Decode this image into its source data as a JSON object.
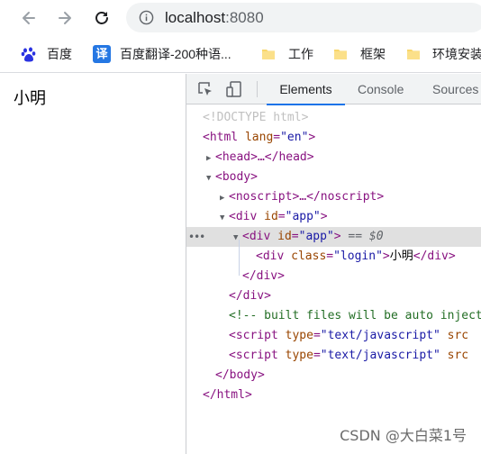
{
  "toolbar": {
    "url_host": "localhost",
    "url_port": ":8080"
  },
  "bookmarks": [
    {
      "label": "百度",
      "icon": "baidu-icon"
    },
    {
      "label": "百度翻译-200种语...",
      "icon": "fanyi-icon",
      "icon_text": "译"
    },
    {
      "label": "工作",
      "icon": "folder-icon"
    },
    {
      "label": "框架",
      "icon": "folder-icon"
    },
    {
      "label": "环境安装",
      "icon": "folder-icon"
    }
  ],
  "page": {
    "text": "小明"
  },
  "devtools": {
    "tabs": [
      "Elements",
      "Console",
      "Sources"
    ],
    "active_tab": "Elements",
    "dom": {
      "doctype": "<!DOCTYPE html>",
      "html_open": "<html",
      "html_lang_attr": "lang",
      "html_lang_val": "\"en\"",
      "head_collapsed": "<head>…</head>",
      "body_open": "<body>",
      "noscript_collapsed": "<noscript>…</noscript>",
      "div_open": "<div",
      "id_attr": "id",
      "app_val": "\"app\"",
      "selected_marker": "== $0",
      "inner_class_attr": "class",
      "inner_class_val": "\"login\"",
      "inner_text": "小明",
      "div_close": "</div>",
      "comment": "<!-- built files will be auto injected -->",
      "script_open": "<script",
      "type_attr": "type",
      "type_val": "\"text/javascript\"",
      "src_attr": "src",
      "body_close": "</body>",
      "html_close": "</html>"
    }
  },
  "watermark": "CSDN @大白菜1号"
}
